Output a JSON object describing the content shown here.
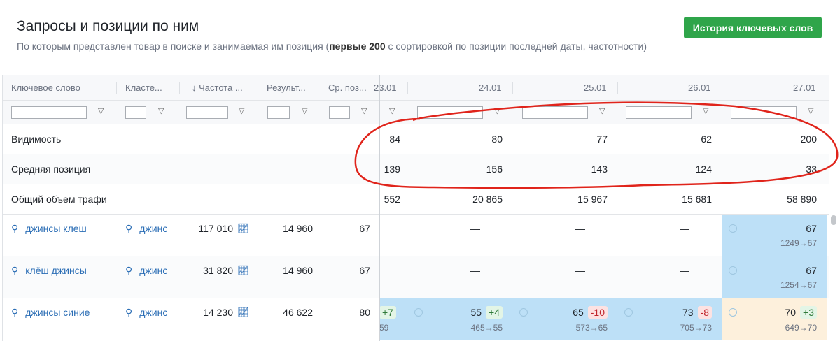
{
  "header": {
    "title": "Запросы и позиции по ним",
    "subtitle_pre": "По которым представлен товар в поиске и занимаемая им позиция (",
    "subtitle_bold": "первые 200",
    "subtitle_post": " с сортировкой по позиции последней даты, частотности)",
    "history_button": "История ключевых слов"
  },
  "columns": {
    "keyword": "Ключевое слово",
    "cluster": "Класте...",
    "freq": "↓ Частота ...",
    "results": "Результ...",
    "avgpos": "Ср. поз...",
    "dates": [
      "23.01",
      "24.01",
      "25.01",
      "26.01",
      "27.01"
    ]
  },
  "summary": [
    {
      "label": "Видимость",
      "values": [
        "84",
        "80",
        "77",
        "62",
        "200"
      ]
    },
    {
      "label": "Средняя позиция",
      "values": [
        "139",
        "156",
        "143",
        "124",
        "33"
      ]
    },
    {
      "label": "Общий объем трафи",
      "values": [
        "552",
        "20 865",
        "15 967",
        "15 681",
        "58 890"
      ]
    }
  ],
  "rows": [
    {
      "keyword": "джинсы клеш",
      "cluster": "джинс",
      "freq": "117 010",
      "results": "14 960",
      "avgpos": "67",
      "d24": "—",
      "d25": "—",
      "d26": "—",
      "d27": {
        "pos": "67",
        "sub": "1249→67"
      }
    },
    {
      "keyword": "клёш джинсы",
      "cluster": "джинс",
      "freq": "31 820",
      "results": "14 960",
      "avgpos": "67",
      "d24": "—",
      "d25": "—",
      "d26": "—",
      "d27": {
        "pos": "67",
        "sub": "1254→67"
      }
    },
    {
      "keyword": "джинсы синие",
      "cluster": "джинс",
      "freq": "14 230",
      "results": "46 622",
      "avgpos": "80",
      "d23": {
        "delta": "+7",
        "sub": "59"
      },
      "d24": {
        "pos": "55",
        "delta": "+4",
        "sub": "465→55"
      },
      "d25": {
        "pos": "65",
        "delta": "-10",
        "sub": "573→65"
      },
      "d26": {
        "pos": "73",
        "delta": "-8",
        "sub": "705→73"
      },
      "d27": {
        "pos": "70",
        "delta": "+3",
        "sub": "649→70"
      }
    }
  ]
}
